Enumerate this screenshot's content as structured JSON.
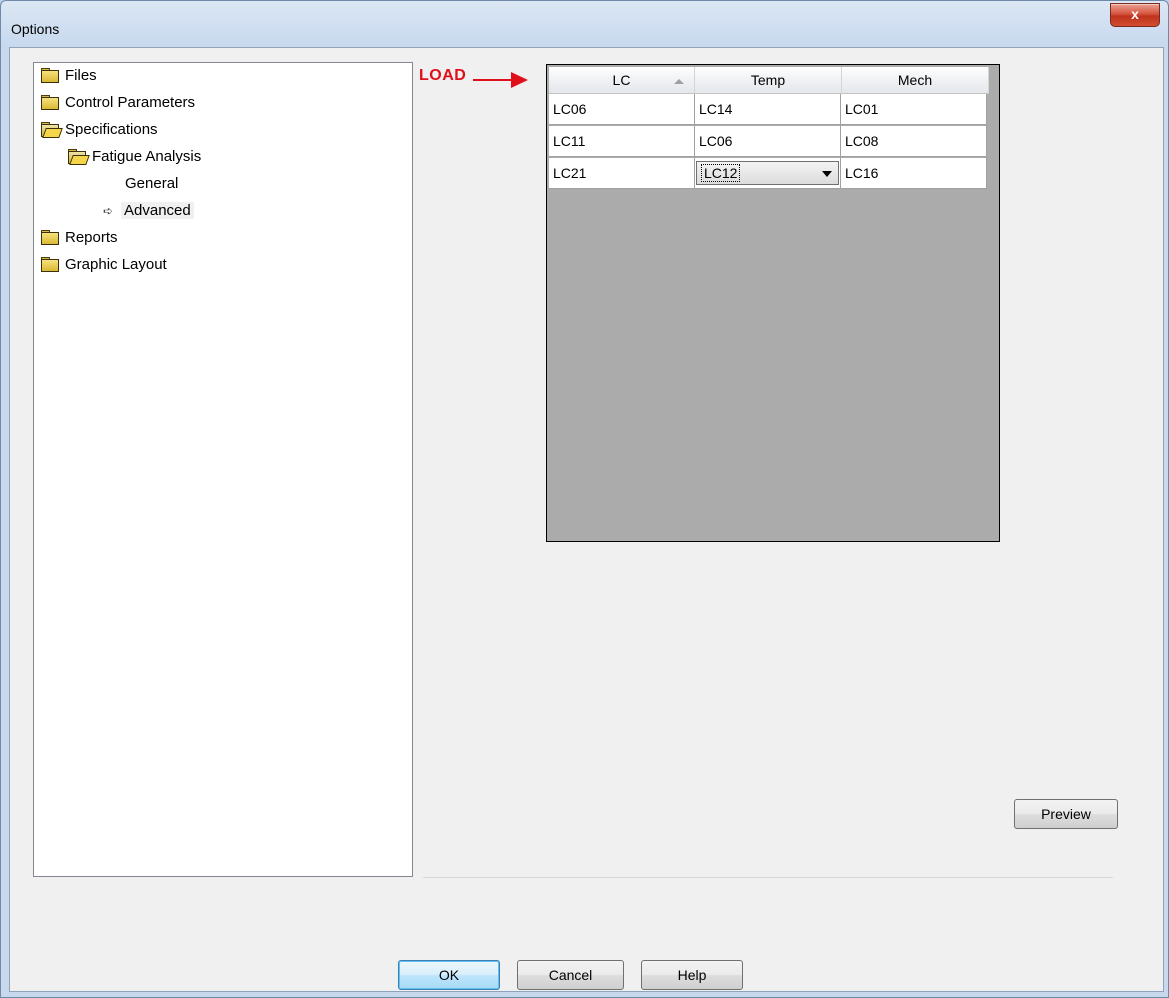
{
  "window": {
    "title": "Options",
    "close_symbol": "x"
  },
  "tree": {
    "items": [
      {
        "label": "Files",
        "icon": "folder-closed-icon"
      },
      {
        "label": "Control Parameters",
        "icon": "folder-closed-icon"
      },
      {
        "label": "Specifications",
        "icon": "folder-open-icon"
      },
      {
        "label": "Fatigue Analysis",
        "icon": "folder-open-icon"
      },
      {
        "label": "General",
        "icon": ""
      },
      {
        "label": "Advanced",
        "icon": "arrow-right-icon",
        "selected": true
      },
      {
        "label": "Reports",
        "icon": "folder-closed-icon"
      },
      {
        "label": "Graphic Layout",
        "icon": "folder-closed-icon"
      }
    ]
  },
  "annotation": {
    "label": "LOAD",
    "color": "#e0101b"
  },
  "grid": {
    "columns": [
      "LC",
      "Temp",
      "Mech"
    ],
    "sorted_column": "LC",
    "rows": [
      [
        "LC06",
        "LC14",
        "LC01"
      ],
      [
        "LC11",
        "LC06",
        "LC08"
      ],
      [
        "LC21",
        "LC12",
        "LC16"
      ]
    ],
    "active_cell": {
      "row": 2,
      "column": 1,
      "editor": "dropdown"
    }
  },
  "buttons": {
    "preview": "Preview",
    "ok": "OK",
    "cancel": "Cancel",
    "help": "Help"
  }
}
